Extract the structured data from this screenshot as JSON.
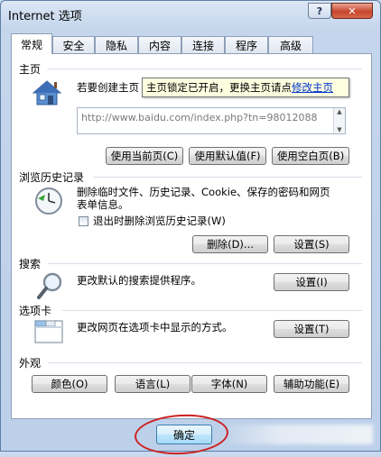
{
  "window": {
    "title": "Internet 选项",
    "help_glyph": "?",
    "close_glyph": "✕"
  },
  "tabs": [
    "常规",
    "安全",
    "隐私",
    "内容",
    "连接",
    "程序",
    "高级"
  ],
  "homepage": {
    "section_title": "主页",
    "description": "若要创建主页",
    "tooltip_text": "主页锁定已开启，更换主页请点",
    "tooltip_link": "修改主页",
    "url": "http://www.baidu.com/index.php?tn=98012088",
    "btn_current": "使用当前页(C)",
    "btn_default": "使用默认值(F)",
    "btn_blank": "使用空白页(B)"
  },
  "history": {
    "section_title": "浏览历史记录",
    "description_line1": "删除临时文件、历史记录、Cookie、保存的密码和网页",
    "description_line2": "表单信息。",
    "checkbox_label": "退出时删除浏览历史记录(W)",
    "btn_delete": "删除(D)...",
    "btn_settings": "设置(S)"
  },
  "search": {
    "section_title": "搜索",
    "description": "更改默认的搜索提供程序。",
    "btn_settings": "设置(I)"
  },
  "tabs_section": {
    "section_title": "选项卡",
    "description": "更改网页在选项卡中显示的方式。",
    "btn_settings": "设置(T)"
  },
  "appearance": {
    "section_title": "外观",
    "btn_colors": "颜色(O)",
    "btn_languages": "语言(L)",
    "btn_fonts": "字体(N)",
    "btn_accessibility": "辅助功能(E)"
  },
  "footer": {
    "btn_ok": "确定"
  },
  "colors": {
    "annotation_red": "#cc2222",
    "link_blue": "#0033cc"
  }
}
